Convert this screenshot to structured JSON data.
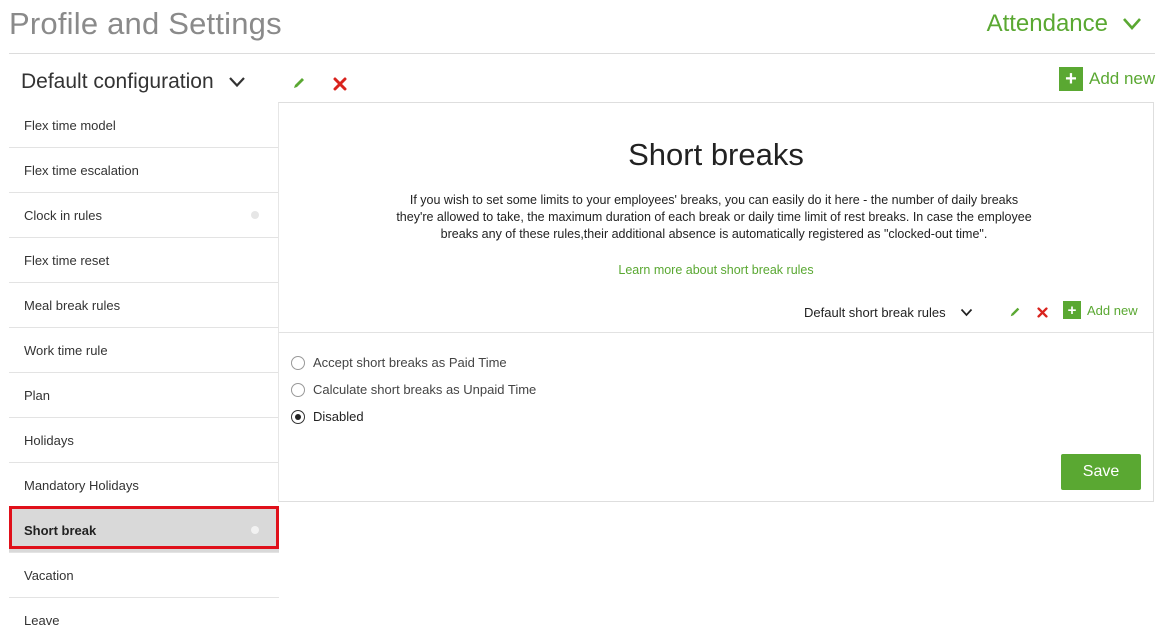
{
  "page": {
    "title": "Profile and Settings"
  },
  "module": {
    "label": "Attendance",
    "icon": "chevron-down-icon"
  },
  "config": {
    "selected": "Default configuration",
    "add_new_label": "Add new",
    "icons": [
      "pencil-icon",
      "delete-icon",
      "plus-icon"
    ]
  },
  "sidebar": {
    "items": [
      {
        "label": "Flex time model",
        "dot": false,
        "active": false
      },
      {
        "label": "Flex time escalation",
        "dot": false,
        "active": false
      },
      {
        "label": "Clock in rules",
        "dot": true,
        "active": false
      },
      {
        "label": "Flex time reset",
        "dot": false,
        "active": false
      },
      {
        "label": "Meal break rules",
        "dot": false,
        "active": false
      },
      {
        "label": "Work time rule",
        "dot": false,
        "active": false
      },
      {
        "label": "Plan",
        "dot": false,
        "active": false
      },
      {
        "label": "Holidays",
        "dot": false,
        "active": false
      },
      {
        "label": "Mandatory Holidays",
        "dot": false,
        "active": false
      },
      {
        "label": "Short break",
        "dot": true,
        "active": true
      },
      {
        "label": "Vacation",
        "dot": false,
        "active": false
      },
      {
        "label": "Leave",
        "dot": false,
        "active": false
      }
    ]
  },
  "main": {
    "title": "Short breaks",
    "description": "If you wish to set some limits to your employees' breaks, you can easily do it here - the number of daily breaks they're allowed to take, the maximum duration of each break or daily time limit of rest breaks. In case the employee breaks any of these rules,their additional absence is automatically registered as \"clocked-out time\".",
    "learn_more": "Learn more about short break rules",
    "rules_selected": "Default short break rules",
    "add_new_label": "Add new",
    "options": [
      {
        "label": "Accept short breaks as Paid Time",
        "checked": false
      },
      {
        "label": "Calculate short breaks as Unpaid Time",
        "checked": false
      },
      {
        "label": "Disabled",
        "checked": true
      }
    ],
    "save_label": "Save"
  },
  "colors": {
    "accent": "#5aa832",
    "delete": "#d9231d",
    "highlight": "#e0101a",
    "active_item_bg": "#d9d9d9"
  }
}
